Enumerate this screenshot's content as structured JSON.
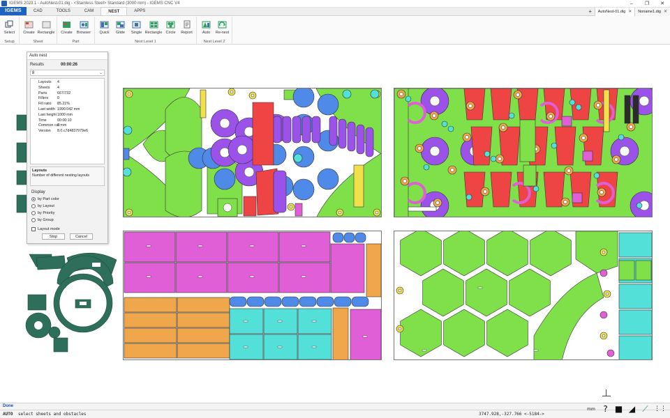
{
  "window": {
    "title": "IGEMS 2023.1 - AutoNest-01.dig - <Stainless Steel> Standard (3000 mm) - IGEMS CNC V4",
    "controls": [
      "–",
      "❐",
      "✕"
    ]
  },
  "brand": "IGEMS",
  "ribbon_tabs": [
    {
      "label": "CAD",
      "active": false
    },
    {
      "label": "TOOLS",
      "active": false
    },
    {
      "label": "CAM",
      "active": false
    },
    {
      "label": "NEST",
      "active": true
    },
    {
      "label": "APPS",
      "active": false
    }
  ],
  "doc_tabs": {
    "plus": "+",
    "tabs": [
      {
        "label": "AutoNest-01.dig",
        "active": true
      },
      {
        "label": "Noname1.dig",
        "active": false
      }
    ],
    "close": "✕"
  },
  "ribbon_groups": [
    {
      "label": "Setup",
      "buttons": [
        {
          "label": "Select",
          "icon": "select-icon",
          "color": "#5b6b80"
        }
      ]
    },
    {
      "label": "Sheet",
      "buttons": [
        {
          "label": "Create",
          "icon": "sheet-create-icon",
          "color": "#d64545"
        },
        {
          "label": "Rectangle",
          "icon": "sheet-rectangle-icon",
          "color": "#8a8a8a"
        }
      ]
    },
    {
      "label": "Part",
      "buttons": [
        {
          "label": "Create",
          "icon": "part-create-icon",
          "color": "#2f9e62"
        },
        {
          "label": "Browser",
          "icon": "part-browser-icon",
          "color": "#3f6fb0"
        }
      ]
    },
    {
      "label": "Nest Level 1",
      "buttons": [
        {
          "label": "Quick",
          "icon": "quick-icon",
          "color": "#3f6fb0"
        },
        {
          "label": "Glide",
          "icon": "glide-icon",
          "color": "#3f6fb0"
        },
        {
          "label": "Single",
          "icon": "single-icon",
          "color": "#3f6fb0"
        },
        {
          "label": "Rectangle",
          "icon": "nest-rectangle-icon",
          "color": "#2f9e62"
        },
        {
          "label": "Circle",
          "icon": "circle-icon",
          "color": "#2f9e62"
        },
        {
          "label": "Report",
          "icon": "report-icon",
          "color": "#707070"
        }
      ]
    },
    {
      "label": "Nest Level 2",
      "buttons": [
        {
          "label": "Auto",
          "icon": "auto-icon",
          "color": "#2f9e62"
        },
        {
          "label": "Re-nest",
          "icon": "renest-icon",
          "color": "#2f9e62"
        }
      ]
    }
  ],
  "autonest_panel": {
    "title": "Auto nest",
    "results_label": "Results",
    "elapsed": "00:00:26",
    "selected_result": "8",
    "stats": [
      {
        "key": "Layouts",
        "value": "4"
      },
      {
        "key": "Sheets",
        "value": "4"
      },
      {
        "key": "Parts",
        "value": "667/732"
      },
      {
        "key": "Fillers",
        "value": "0"
      },
      {
        "key": "Fill ratio",
        "value": "85.21%"
      },
      {
        "key": "Last width",
        "value": "1990.042 mm"
      },
      {
        "key": "Last height",
        "value": "1000 mm"
      },
      {
        "key": "Time",
        "value": "00:00:10"
      },
      {
        "key": "Common cut",
        "value": "0 mm"
      },
      {
        "key": "Version",
        "value": "8.0.c7d4837979e6"
      }
    ],
    "description_title": "Layouts",
    "description_text": "Number of different nesting layouts",
    "display_label": "Display",
    "display_options": [
      {
        "label": "by Part color",
        "selected": true
      },
      {
        "label": "by Layout",
        "selected": false
      },
      {
        "label": "by Priority",
        "selected": false
      },
      {
        "label": "by Group",
        "selected": false
      }
    ],
    "layout_mode_label": "Layout mode",
    "stop_label": "Stop",
    "cancel_label": "Cancel"
  },
  "cmdline": {
    "text": "Done"
  },
  "statusbar": {
    "mode": "AUTO",
    "prompt": "select sheets and obstacles",
    "coords": "3747.928,-327.766 <-5184->",
    "tools": [
      {
        "icon": "units-icon",
        "glyph": "mm"
      },
      {
        "icon": "help-icon",
        "glyph": "?"
      },
      {
        "icon": "color-swatch-icon",
        "glyph": "■"
      },
      {
        "icon": "snap-angle-icon",
        "glyph": "◢"
      },
      {
        "icon": "measure-icon",
        "glyph": "⟋"
      },
      {
        "icon": "grid-icon",
        "glyph": "⋮⋮"
      }
    ]
  },
  "colors": {
    "green": "#7fe04a",
    "magenta": "#e05fd6",
    "orange": "#f0a64a",
    "cyan": "#52e0d8",
    "blue": "#4f8ae8",
    "purple": "#9a52e8",
    "red": "#ee4444",
    "yellow": "#f2e04a",
    "teal_parts": "#2e6f5c",
    "accent": "#1e63c4"
  }
}
